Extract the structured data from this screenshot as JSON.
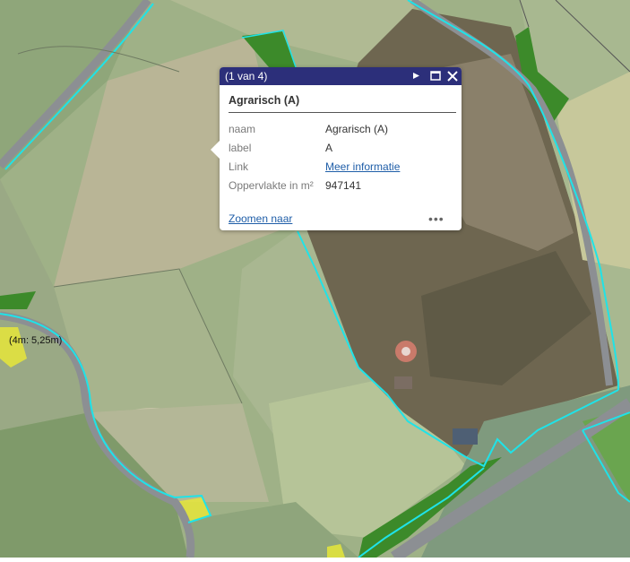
{
  "popup": {
    "count": "(1 van 4)",
    "title": "Agrarisch (A)",
    "attributes": [
      {
        "key": "naam",
        "value": "Agrarisch (A)"
      },
      {
        "key": "label",
        "value": "A"
      },
      {
        "key": "Link",
        "value": "Meer informatie"
      },
      {
        "key": "Oppervlakte in m²",
        "value": "947141"
      }
    ],
    "zoom_label": "Zoomen naar",
    "more_label": "•••",
    "next_icon": "play-icon",
    "maximize_icon": "maximize-icon",
    "close_icon": "close-icon"
  },
  "map": {
    "dimension_label": "(4m: 5,25m)",
    "colors": {
      "parcel_outline": "#1fe3e8",
      "road": "#8c8f93",
      "green_zone": "#3c8a2a",
      "yellow_zone": "#e6e63a",
      "header": "#2c2f7a"
    }
  }
}
